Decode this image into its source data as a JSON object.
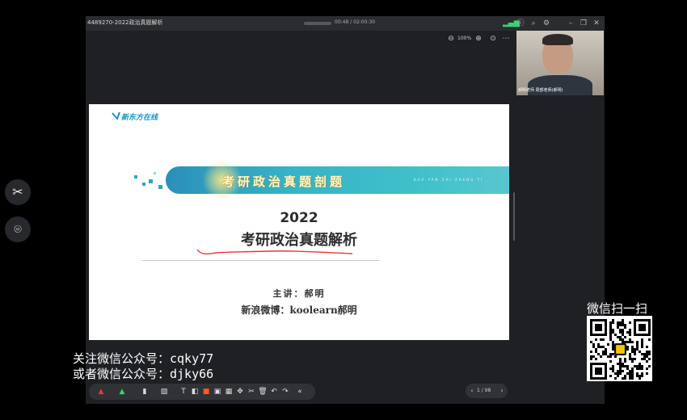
{
  "window": {
    "title": "4489270-2022政治真题解析",
    "timecode": "00:48 / 02:00:30",
    "zoom_level": "100%"
  },
  "slide": {
    "logo": "新东方在线",
    "banner_title": "考研政治真题剖题",
    "banner_pinyin": "KAO YAN ZHI ZHENG TI",
    "year": "2022",
    "title": "考研政治真题解析",
    "speaker": "主讲：郝明",
    "weibo": "新浪微博：koolearn郝明"
  },
  "video": {
    "label": "郝明老师 局部老师(郝明)"
  },
  "pager": {
    "page": "1 / 98"
  },
  "overlay": {
    "line1": "关注微信公众号：cqky77",
    "line2": "或者微信公众号：djky66",
    "scan_label": "微信扫一扫"
  },
  "colors": {
    "accent": "#3ec0c9",
    "panel": "#1e2024",
    "underline": "#e33a3a"
  }
}
